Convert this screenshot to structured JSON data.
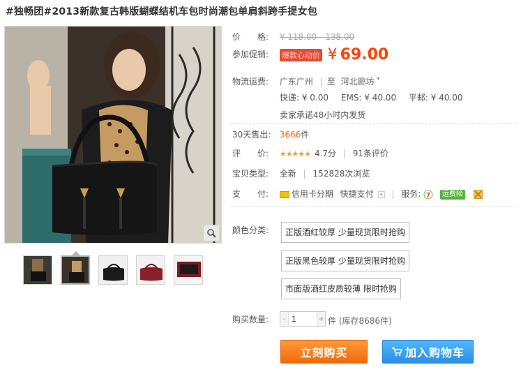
{
  "product": {
    "title": "#独畅团#2013新款复古韩版蝴蝶结机车包时尚潮包单肩斜跨手提女包"
  },
  "price": {
    "label": "价　　格:",
    "original": "¥ 118.00 - 138.00"
  },
  "promo": {
    "label": "参加促销:",
    "badge": "爆款心动价",
    "currency": "¥",
    "value": "69.00"
  },
  "shipping": {
    "label": "物流运费:",
    "from": "广东广州",
    "to_prefix": "至",
    "to": "河北廊坊",
    "express": "快递: ¥ 0.00",
    "ems": "EMS: ¥ 40.00",
    "regular": "平邮: ¥ 40.00",
    "promise": "卖家承诺48小时内发货"
  },
  "sales": {
    "label": "30天售出:",
    "count": "3666",
    "unit": "件"
  },
  "rating": {
    "label": "评　　价:",
    "stars": "★★★★★",
    "score": "4.7分",
    "reviews": "91条评价"
  },
  "type": {
    "label": "宝贝类型:",
    "value": "全新",
    "views": "152828次浏览"
  },
  "payment": {
    "label": "支　　付:",
    "credit": "信用卡分期",
    "quick": "快捷支付",
    "service_label": "服务:",
    "service_badge": "运费险"
  },
  "color": {
    "label": "颜色分类:",
    "options": [
      "正版酒红较厚 少量现货限时抢购",
      "正版黑色较厚 少量现货限时抢购",
      "市面版酒红皮质较薄 限时抢购"
    ]
  },
  "quantity": {
    "label": "购买数量:",
    "value": "1",
    "unit": "件",
    "stock": "(库存8686件)"
  },
  "actions": {
    "buy": "立刻购买",
    "cart": "加入购物车"
  },
  "colors": {
    "price": "#ff4400",
    "buy_button": "#f77a1a",
    "cart_button": "#2a8fe6"
  }
}
